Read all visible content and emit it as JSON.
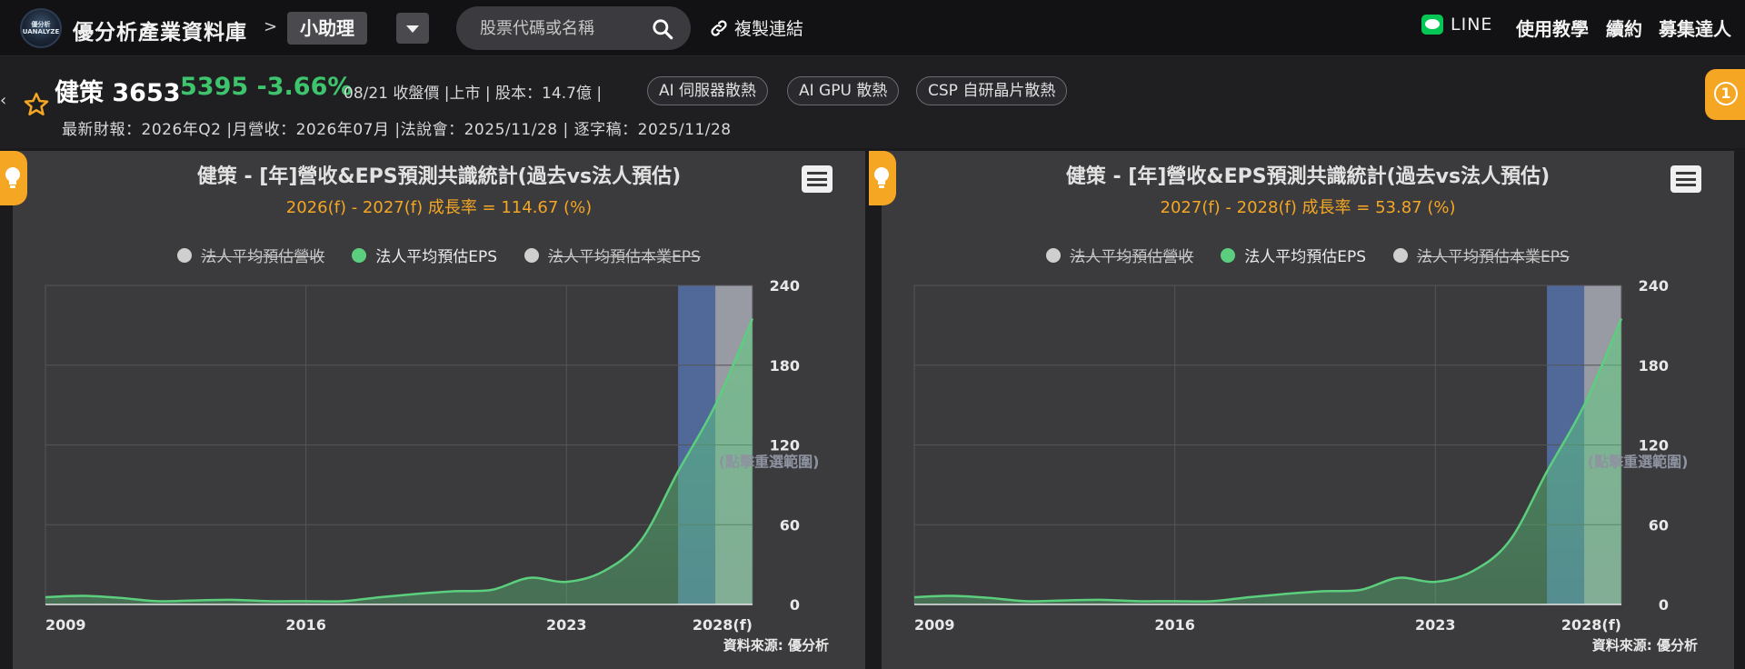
{
  "topbar": {
    "logo_text_line1": "優分析",
    "logo_text_line2": "UANALYZE",
    "site_title": "優分析產業資料庫",
    "breadcrumb_sep": ">",
    "assistant_label": "小助理",
    "search_placeholder": "股票代碼或名稱",
    "copy_link_label": "複製連結",
    "line_label": "LINE",
    "nav": [
      "使用教學",
      "續約",
      "募集達人"
    ]
  },
  "stock": {
    "name": "健策 3653",
    "price_change": "5395 -3.66%",
    "meta": "08/21 收盤價 |上市 | 股本：14.7億 |",
    "tags": [
      "AI 伺服器散熱",
      "AI GPU 散熱",
      "CSP 自研晶片散熱"
    ],
    "sub": "最新財報：2026年Q2 |月營收：2026年07月 |法說會：2025/11/28 | 逐字稿：2025/11/28",
    "notification_count": "1"
  },
  "colors": {
    "eps_line": "#5ccf7e",
    "highlight_blue": "#5a79b8",
    "highlight_white": "#b8bcc6",
    "accent": "#f5a623",
    "up_green": "#3ec46d"
  },
  "chart_data": [
    {
      "type": "area",
      "title": "健策 - [年]營收&EPS預測共識統計(過去vs法人預估)",
      "subtitle": "2026(f) - 2027(f) 成長率 = 114.67 (%)",
      "legend": [
        "法人平均預估營收",
        "法人平均預估EPS",
        "法人平均預估本業EPS"
      ],
      "legend_enabled": [
        false,
        true,
        false
      ],
      "x": [
        2009,
        2010,
        2011,
        2012,
        2013,
        2014,
        2015,
        2016,
        2017,
        2018,
        2019,
        2020,
        2021,
        2022,
        2023,
        2024,
        2025,
        2026,
        2027,
        2028
      ],
      "x_tick_labels": [
        "2009",
        "2016",
        "2023",
        "2028(f)"
      ],
      "series": [
        {
          "name": "法人平均預估EPS",
          "values": [
            5.5,
            6.5,
            5,
            2.5,
            3,
            3.5,
            2.5,
            2.5,
            2.5,
            5.5,
            8,
            10,
            11,
            20,
            17,
            25,
            48,
            100,
            150,
            215
          ]
        }
      ],
      "ylim": [
        0,
        240
      ],
      "y_ticks": [
        0,
        60,
        120,
        180,
        240
      ],
      "highlight_blue_range": [
        2026,
        2027
      ],
      "highlight_white_range": [
        2027,
        2028
      ],
      "annotation": "(點擊重選範圍)",
      "source": "資料來源: 優分析"
    },
    {
      "type": "area",
      "title": "健策 - [年]營收&EPS預測共識統計(過去vs法人預估)",
      "subtitle": "2027(f) - 2028(f) 成長率 = 53.87 (%)",
      "legend": [
        "法人平均預估營收",
        "法人平均預估EPS",
        "法人平均預估本業EPS"
      ],
      "legend_enabled": [
        false,
        true,
        false
      ],
      "x": [
        2009,
        2010,
        2011,
        2012,
        2013,
        2014,
        2015,
        2016,
        2017,
        2018,
        2019,
        2020,
        2021,
        2022,
        2023,
        2024,
        2025,
        2026,
        2027,
        2028
      ],
      "x_tick_labels": [
        "2009",
        "2016",
        "2023",
        "2028(f)"
      ],
      "series": [
        {
          "name": "法人平均預估EPS",
          "values": [
            5.5,
            6.5,
            5,
            2.5,
            3,
            3.5,
            2.5,
            2.5,
            2.5,
            5.5,
            8,
            10,
            11,
            20,
            17,
            25,
            48,
            100,
            150,
            215
          ]
        }
      ],
      "ylim": [
        0,
        240
      ],
      "y_ticks": [
        0,
        60,
        120,
        180,
        240
      ],
      "highlight_blue_range": [
        2026,
        2027
      ],
      "highlight_white_range": [
        2027,
        2028
      ],
      "annotation": "(點擊重選範圍)",
      "source": "資料來源: 優分析"
    }
  ]
}
